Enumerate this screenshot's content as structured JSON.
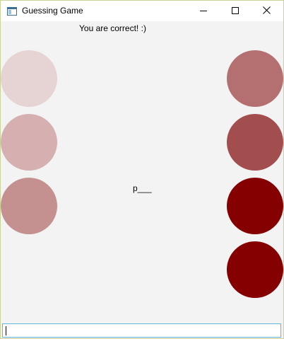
{
  "window": {
    "title": "Guessing Game"
  },
  "game": {
    "status": "You are correct! :)",
    "word": "p___",
    "input_value": ""
  },
  "circles": {
    "left": [
      {
        "color": "#e6d3d3"
      },
      {
        "color": "#d6b0b0"
      },
      {
        "color": "#c59090"
      }
    ],
    "right": [
      {
        "color": "#b47070"
      },
      {
        "color": "#a34e4e"
      },
      {
        "color": "#850000"
      },
      {
        "color": "#850000"
      }
    ]
  },
  "icons": {
    "app": "app-window-icon",
    "minimize": "minimize-icon",
    "maximize": "maximize-icon",
    "close": "close-icon"
  }
}
